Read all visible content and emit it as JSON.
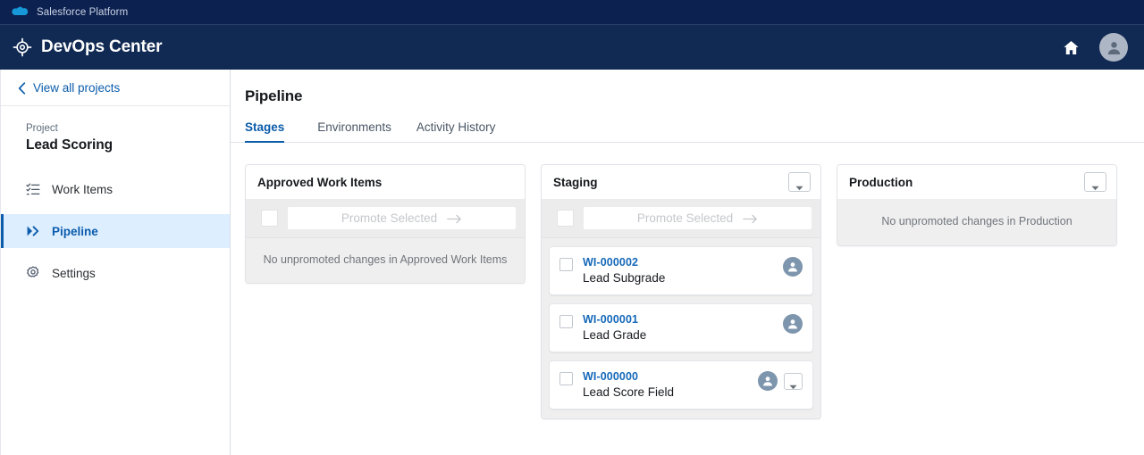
{
  "global_header": {
    "platform_label": "Salesforce Platform",
    "cloud_icon": "salesforce-cloud-icon"
  },
  "app_header": {
    "title": "DevOps Center",
    "brand_icon": "target-crosshair-icon",
    "home_icon": "home-icon",
    "avatar_icon": "user-avatar-icon"
  },
  "sidebar": {
    "back_link": "View all projects",
    "back_icon": "chevron-left-icon",
    "project_eyebrow": "Project",
    "project_name": "Lead Scoring",
    "items": [
      {
        "label": "Work Items",
        "icon": "checklist-icon",
        "active": false
      },
      {
        "label": "Pipeline",
        "icon": "double-chevron-icon",
        "active": true
      },
      {
        "label": "Settings",
        "icon": "gear-icon",
        "active": false
      }
    ]
  },
  "main": {
    "page_title": "Pipeline",
    "tabs": [
      {
        "label": "Stages",
        "active": true
      },
      {
        "label": "Environments",
        "active": false
      },
      {
        "label": "Activity History",
        "active": false
      }
    ]
  },
  "pipeline": {
    "promote_button_label": "Promote Selected",
    "promote_arrow": "arrow-right-icon",
    "stages": [
      {
        "name": "Approved Work Items",
        "has_menu": false,
        "has_promote_bar": true,
        "empty_message": "No unpromoted changes in Approved Work Items",
        "work_items": []
      },
      {
        "name": "Staging",
        "has_menu": true,
        "menu_icon": "caret-down-icon",
        "has_promote_bar": true,
        "empty_message": null,
        "work_items": [
          {
            "id": "WI-000002",
            "name": "Lead Subgrade",
            "avatar_icon": "user-avatar-icon",
            "has_menu": false
          },
          {
            "id": "WI-000001",
            "name": "Lead Grade",
            "avatar_icon": "user-avatar-icon",
            "has_menu": false
          },
          {
            "id": "WI-000000",
            "name": "Lead Score Field",
            "avatar_icon": "user-avatar-icon",
            "has_menu": true
          }
        ]
      },
      {
        "name": "Production",
        "has_menu": true,
        "menu_icon": "caret-down-icon",
        "has_promote_bar": false,
        "empty_message": "No unpromoted changes in Production",
        "work_items": []
      }
    ]
  },
  "colors": {
    "header_navy": "#112a53",
    "strip_navy": "#0d2150",
    "link_blue": "#0b5cab",
    "active_nav_bg": "#ddeeff",
    "work_item_blue": "#1568b8",
    "avatar_slate": "#7d95ad"
  }
}
